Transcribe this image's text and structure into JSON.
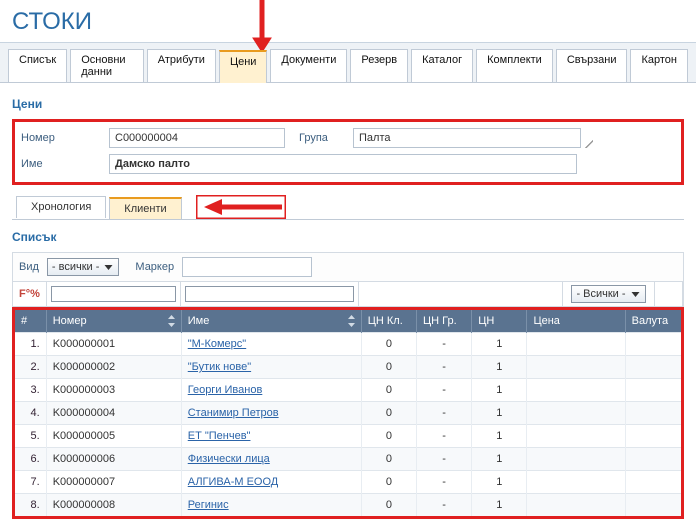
{
  "page_title": "СТОКИ",
  "main_tabs": [
    "Списък",
    "Основни данни",
    "Атрибути",
    "Цени",
    "Документи",
    "Резерв",
    "Каталог",
    "Комплекти",
    "Свързани",
    "Картон"
  ],
  "main_tab_active": 3,
  "prices_section_title": "Цени",
  "form": {
    "number_label": "Номер",
    "number_value": "C000000004",
    "group_label": "Група",
    "group_value": "Палта",
    "name_label": "Име",
    "name_value": "Дамско палто"
  },
  "sub_tabs": [
    "Хронология",
    "Клиенти"
  ],
  "sub_tab_active": 1,
  "list_section_title": "Списък",
  "filters": {
    "type_label": "Вид",
    "type_value": "- всички -",
    "marker_label": "Маркер",
    "marker_value": "",
    "func_label": "F°%",
    "scope_value": "- Всички -"
  },
  "columns": {
    "idx": "#",
    "number": "Номер",
    "name": "Име",
    "cn_client": "ЦН Кл.",
    "cn_group": "ЦН Гр.",
    "cn": "ЦН",
    "price": "Цена",
    "currency": "Валута"
  },
  "rows": [
    {
      "idx": "1.",
      "number": "K000000001",
      "name": "\"М-Комерс\"",
      "cn_client": "0",
      "cn_group": "-",
      "cn": "1",
      "price": "",
      "currency": ""
    },
    {
      "idx": "2.",
      "number": "K000000002",
      "name": "\"Бутик нове\"",
      "cn_client": "0",
      "cn_group": "-",
      "cn": "1",
      "price": "",
      "currency": ""
    },
    {
      "idx": "3.",
      "number": "K000000003",
      "name": "Георги Иванов",
      "cn_client": "0",
      "cn_group": "-",
      "cn": "1",
      "price": "",
      "currency": ""
    },
    {
      "idx": "4.",
      "number": "K000000004",
      "name": "Станимир Петров",
      "cn_client": "0",
      "cn_group": "-",
      "cn": "1",
      "price": "",
      "currency": ""
    },
    {
      "idx": "5.",
      "number": "K000000005",
      "name": "ЕТ \"Пенчев\"",
      "cn_client": "0",
      "cn_group": "-",
      "cn": "1",
      "price": "",
      "currency": ""
    },
    {
      "idx": "6.",
      "number": "K000000006",
      "name": "Физически лица",
      "cn_client": "0",
      "cn_group": "-",
      "cn": "1",
      "price": "",
      "currency": ""
    },
    {
      "idx": "7.",
      "number": "K000000007",
      "name": "АЛГИВА-М ЕООД",
      "cn_client": "0",
      "cn_group": "-",
      "cn": "1",
      "price": "",
      "currency": ""
    },
    {
      "idx": "8.",
      "number": "K000000008",
      "name": "Регинис",
      "cn_client": "0",
      "cn_group": "-",
      "cn": "1",
      "price": "",
      "currency": ""
    }
  ]
}
